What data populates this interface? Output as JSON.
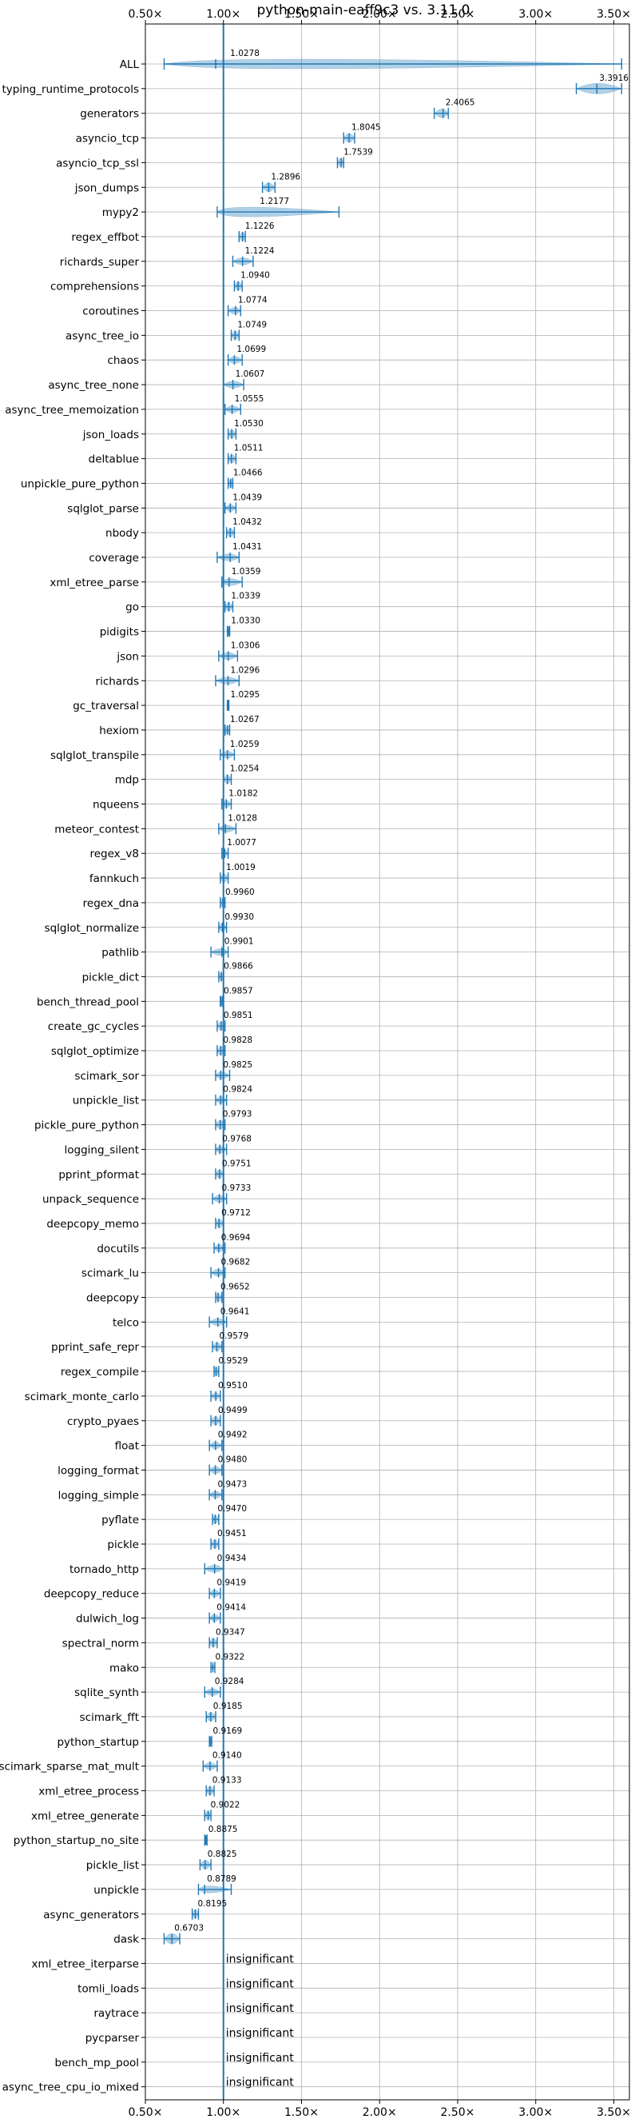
{
  "chart_data": {
    "type": "violin",
    "title": "python-main-eaff9c3 vs. 3.11.0",
    "xlim": [
      0.5,
      3.6
    ],
    "xticks": [
      {
        "value": 0.5,
        "label": "0.50×"
      },
      {
        "value": 1.0,
        "label": "1.00×"
      },
      {
        "value": 1.5,
        "label": "1.50×"
      },
      {
        "value": 2.0,
        "label": "2.00×"
      },
      {
        "value": 2.5,
        "label": "2.50×"
      },
      {
        "value": 3.0,
        "label": "3.00×"
      },
      {
        "value": 3.5,
        "label": "3.50×"
      }
    ],
    "reference_line": 1.0,
    "grid": true,
    "colors": {
      "violin": "#1f77b4",
      "ref_line": "#1f77b4",
      "grid": "#b0b0b0"
    },
    "insignificant_text": "insignificant",
    "benchmarks": [
      {
        "name": "ALL",
        "mean": "1.0278",
        "center": 0.95,
        "min": 0.62,
        "max": 3.55,
        "width": 0.55
      },
      {
        "name": "typing_runtime_protocols",
        "mean": "3.3916",
        "center": 3.3916,
        "min": 3.26,
        "max": 3.55,
        "width": 0.6
      },
      {
        "name": "generators",
        "mean": "2.4065",
        "center": 2.4065,
        "min": 2.35,
        "max": 2.44,
        "width": 0.5
      },
      {
        "name": "asyncio_tcp",
        "mean": "1.8045",
        "center": 1.8045,
        "min": 1.77,
        "max": 1.84,
        "width": 0.5
      },
      {
        "name": "asyncio_tcp_ssl",
        "mean": "1.7539",
        "center": 1.7539,
        "min": 1.73,
        "max": 1.77,
        "width": 0.5
      },
      {
        "name": "json_dumps",
        "mean": "1.2896",
        "center": 1.2896,
        "min": 1.25,
        "max": 1.33,
        "width": 0.5
      },
      {
        "name": "mypy2",
        "mean": "1.2177",
        "center": 1.0,
        "min": 0.96,
        "max": 1.74,
        "width": 0.55
      },
      {
        "name": "regex_effbot",
        "mean": "1.1226",
        "center": 1.1226,
        "min": 1.1,
        "max": 1.14,
        "width": 0.5
      },
      {
        "name": "richards_super",
        "mean": "1.1224",
        "center": 1.1224,
        "min": 1.06,
        "max": 1.19,
        "width": 0.4
      },
      {
        "name": "comprehensions",
        "mean": "1.0940",
        "center": 1.094,
        "min": 1.07,
        "max": 1.12,
        "width": 0.5
      },
      {
        "name": "coroutines",
        "mean": "1.0774",
        "center": 1.0774,
        "min": 1.03,
        "max": 1.11,
        "width": 0.4
      },
      {
        "name": "async_tree_io",
        "mean": "1.0749",
        "center": 1.0749,
        "min": 1.05,
        "max": 1.1,
        "width": 0.5
      },
      {
        "name": "chaos",
        "mean": "1.0699",
        "center": 1.0699,
        "min": 1.03,
        "max": 1.12,
        "width": 0.4
      },
      {
        "name": "async_tree_none",
        "mean": "1.0607",
        "center": 1.0607,
        "min": 1.0,
        "max": 1.13,
        "width": 0.4
      },
      {
        "name": "async_tree_memoization",
        "mean": "1.0555",
        "center": 1.0555,
        "min": 1.01,
        "max": 1.11,
        "width": 0.4
      },
      {
        "name": "json_loads",
        "mean": "1.0530",
        "center": 1.053,
        "min": 1.03,
        "max": 1.08,
        "width": 0.5
      },
      {
        "name": "deltablue",
        "mean": "1.0511",
        "center": 1.0511,
        "min": 1.03,
        "max": 1.08,
        "width": 0.5
      },
      {
        "name": "unpickle_pure_python",
        "mean": "1.0466",
        "center": 1.0466,
        "min": 1.03,
        "max": 1.06,
        "width": 0.5
      },
      {
        "name": "sqlglot_parse",
        "mean": "1.0439",
        "center": 1.0439,
        "min": 1.01,
        "max": 1.08,
        "width": 0.4
      },
      {
        "name": "nbody",
        "mean": "1.0432",
        "center": 1.0432,
        "min": 1.02,
        "max": 1.07,
        "width": 0.5
      },
      {
        "name": "coverage",
        "mean": "1.0431",
        "center": 1.0431,
        "min": 0.96,
        "max": 1.1,
        "width": 0.4
      },
      {
        "name": "xml_etree_parse",
        "mean": "1.0359",
        "center": 1.0359,
        "min": 0.99,
        "max": 1.12,
        "width": 0.4
      },
      {
        "name": "go",
        "mean": "1.0339",
        "center": 1.0339,
        "min": 1.01,
        "max": 1.06,
        "width": 0.5
      },
      {
        "name": "pidigits",
        "mean": "1.0330",
        "center": 1.033,
        "min": 1.025,
        "max": 1.04,
        "width": 0.3
      },
      {
        "name": "json",
        "mean": "1.0306",
        "center": 1.0306,
        "min": 0.97,
        "max": 1.09,
        "width": 0.4
      },
      {
        "name": "richards",
        "mean": "1.0296",
        "center": 1.0296,
        "min": 0.95,
        "max": 1.1,
        "width": 0.4
      },
      {
        "name": "gc_traversal",
        "mean": "1.0295",
        "center": 1.0295,
        "min": 1.025,
        "max": 1.035,
        "width": 0.3
      },
      {
        "name": "hexiom",
        "mean": "1.0267",
        "center": 1.0267,
        "min": 1.01,
        "max": 1.04,
        "width": 0.5
      },
      {
        "name": "sqlglot_transpile",
        "mean": "1.0259",
        "center": 1.0259,
        "min": 0.98,
        "max": 1.07,
        "width": 0.4
      },
      {
        "name": "mdp",
        "mean": "1.0254",
        "center": 1.0254,
        "min": 1.0,
        "max": 1.05,
        "width": 0.5
      },
      {
        "name": "nqueens",
        "mean": "1.0182",
        "center": 1.0182,
        "min": 0.99,
        "max": 1.05,
        "width": 0.4
      },
      {
        "name": "meteor_contest",
        "mean": "1.0128",
        "center": 1.0128,
        "min": 0.97,
        "max": 1.08,
        "width": 0.4
      },
      {
        "name": "regex_v8",
        "mean": "1.0077",
        "center": 1.0077,
        "min": 0.99,
        "max": 1.03,
        "width": 0.4
      },
      {
        "name": "fannkuch",
        "mean": "1.0019",
        "center": 1.0019,
        "min": 0.98,
        "max": 1.03,
        "width": 0.5
      },
      {
        "name": "regex_dna",
        "mean": "0.9960",
        "center": 0.996,
        "min": 0.98,
        "max": 1.01,
        "width": 0.5
      },
      {
        "name": "sqlglot_normalize",
        "mean": "0.9930",
        "center": 0.993,
        "min": 0.97,
        "max": 1.02,
        "width": 0.5
      },
      {
        "name": "pathlib",
        "mean": "0.9901",
        "center": 0.9901,
        "min": 0.92,
        "max": 1.03,
        "width": 0.4
      },
      {
        "name": "pickle_dict",
        "mean": "0.9866",
        "center": 0.9866,
        "min": 0.97,
        "max": 1.0,
        "width": 0.5
      },
      {
        "name": "bench_thread_pool",
        "mean": "0.9857",
        "center": 0.9857,
        "min": 0.98,
        "max": 0.995,
        "width": 0.4
      },
      {
        "name": "create_gc_cycles",
        "mean": "0.9851",
        "center": 0.9851,
        "min": 0.96,
        "max": 1.01,
        "width": 0.5
      },
      {
        "name": "sqlglot_optimize",
        "mean": "0.9828",
        "center": 0.9828,
        "min": 0.96,
        "max": 1.01,
        "width": 0.5
      },
      {
        "name": "scimark_sor",
        "mean": "0.9825",
        "center": 0.9825,
        "min": 0.95,
        "max": 1.04,
        "width": 0.4
      },
      {
        "name": "unpickle_list",
        "mean": "0.9824",
        "center": 0.9824,
        "min": 0.95,
        "max": 1.02,
        "width": 0.4
      },
      {
        "name": "pickle_pure_python",
        "mean": "0.9793",
        "center": 0.9793,
        "min": 0.95,
        "max": 1.01,
        "width": 0.5
      },
      {
        "name": "logging_silent",
        "mean": "0.9768",
        "center": 0.9768,
        "min": 0.95,
        "max": 1.02,
        "width": 0.4
      },
      {
        "name": "pprint_pformat",
        "mean": "0.9751",
        "center": 0.9751,
        "min": 0.95,
        "max": 1.0,
        "width": 0.5
      },
      {
        "name": "unpack_sequence",
        "mean": "0.9733",
        "center": 0.9733,
        "min": 0.93,
        "max": 1.02,
        "width": 0.4
      },
      {
        "name": "deepcopy_memo",
        "mean": "0.9712",
        "center": 0.9712,
        "min": 0.95,
        "max": 1.0,
        "width": 0.5
      },
      {
        "name": "docutils",
        "mean": "0.9694",
        "center": 0.9694,
        "min": 0.94,
        "max": 1.01,
        "width": 0.4
      },
      {
        "name": "scimark_lu",
        "mean": "0.9682",
        "center": 0.9682,
        "min": 0.92,
        "max": 1.01,
        "width": 0.4
      },
      {
        "name": "deepcopy",
        "mean": "0.9652",
        "center": 0.9652,
        "min": 0.95,
        "max": 0.99,
        "width": 0.5
      },
      {
        "name": "telco",
        "mean": "0.9641",
        "center": 0.9641,
        "min": 0.91,
        "max": 1.02,
        "width": 0.4
      },
      {
        "name": "pprint_safe_repr",
        "mean": "0.9579",
        "center": 0.9579,
        "min": 0.93,
        "max": 0.99,
        "width": 0.5
      },
      {
        "name": "regex_compile",
        "mean": "0.9529",
        "center": 0.9529,
        "min": 0.94,
        "max": 0.97,
        "width": 0.5
      },
      {
        "name": "scimark_monte_carlo",
        "mean": "0.9510",
        "center": 0.951,
        "min": 0.92,
        "max": 0.98,
        "width": 0.4
      },
      {
        "name": "crypto_pyaes",
        "mean": "0.9499",
        "center": 0.9499,
        "min": 0.92,
        "max": 0.98,
        "width": 0.5
      },
      {
        "name": "float",
        "mean": "0.9492",
        "center": 0.9492,
        "min": 0.91,
        "max": 0.99,
        "width": 0.4
      },
      {
        "name": "logging_format",
        "mean": "0.9480",
        "center": 0.948,
        "min": 0.91,
        "max": 0.99,
        "width": 0.4
      },
      {
        "name": "logging_simple",
        "mean": "0.9473",
        "center": 0.9473,
        "min": 0.91,
        "max": 0.99,
        "width": 0.4
      },
      {
        "name": "pyflate",
        "mean": "0.9470",
        "center": 0.947,
        "min": 0.93,
        "max": 0.97,
        "width": 0.5
      },
      {
        "name": "pickle",
        "mean": "0.9451",
        "center": 0.9451,
        "min": 0.92,
        "max": 0.97,
        "width": 0.5
      },
      {
        "name": "tornado_http",
        "mean": "0.9434",
        "center": 0.9434,
        "min": 0.88,
        "max": 1.0,
        "width": 0.4
      },
      {
        "name": "deepcopy_reduce",
        "mean": "0.9419",
        "center": 0.9419,
        "min": 0.91,
        "max": 0.98,
        "width": 0.4
      },
      {
        "name": "dulwich_log",
        "mean": "0.9414",
        "center": 0.9414,
        "min": 0.91,
        "max": 0.98,
        "width": 0.4
      },
      {
        "name": "spectral_norm",
        "mean": "0.9347",
        "center": 0.9347,
        "min": 0.91,
        "max": 0.96,
        "width": 0.5
      },
      {
        "name": "mako",
        "mean": "0.9322",
        "center": 0.9322,
        "min": 0.92,
        "max": 0.945,
        "width": 0.3
      },
      {
        "name": "sqlite_synth",
        "mean": "0.9284",
        "center": 0.9284,
        "min": 0.88,
        "max": 0.98,
        "width": 0.4
      },
      {
        "name": "scimark_fft",
        "mean": "0.9185",
        "center": 0.9185,
        "min": 0.89,
        "max": 0.95,
        "width": 0.5
      },
      {
        "name": "python_startup",
        "mean": "0.9169",
        "center": 0.9169,
        "min": 0.91,
        "max": 0.925,
        "width": 0.3
      },
      {
        "name": "scimark_sparse_mat_mult",
        "mean": "0.9140",
        "center": 0.914,
        "min": 0.87,
        "max": 0.96,
        "width": 0.4
      },
      {
        "name": "xml_etree_process",
        "mean": "0.9133",
        "center": 0.9133,
        "min": 0.89,
        "max": 0.94,
        "width": 0.5
      },
      {
        "name": "xml_etree_generate",
        "mean": "0.9022",
        "center": 0.9022,
        "min": 0.88,
        "max": 0.92,
        "width": 0.5
      },
      {
        "name": "python_startup_no_site",
        "mean": "0.8875",
        "center": 0.8875,
        "min": 0.88,
        "max": 0.895,
        "width": 0.3
      },
      {
        "name": "pickle_list",
        "mean": "0.8825",
        "center": 0.8825,
        "min": 0.85,
        "max": 0.92,
        "width": 0.5
      },
      {
        "name": "unpickle",
        "mean": "0.8789",
        "center": 0.8789,
        "min": 0.84,
        "max": 1.05,
        "width": 0.4
      },
      {
        "name": "async_generators",
        "mean": "0.8195",
        "center": 0.8195,
        "min": 0.8,
        "max": 0.84,
        "width": 0.5
      },
      {
        "name": "dask",
        "mean": "0.6703",
        "center": 0.6703,
        "min": 0.62,
        "max": 0.72,
        "width": 0.6
      },
      {
        "name": "xml_etree_iterparse",
        "insignificant": true
      },
      {
        "name": "tomli_loads",
        "insignificant": true
      },
      {
        "name": "raytrace",
        "insignificant": true
      },
      {
        "name": "pycparser",
        "insignificant": true
      },
      {
        "name": "bench_mp_pool",
        "insignificant": true
      },
      {
        "name": "async_tree_cpu_io_mixed",
        "insignificant": true
      }
    ]
  }
}
